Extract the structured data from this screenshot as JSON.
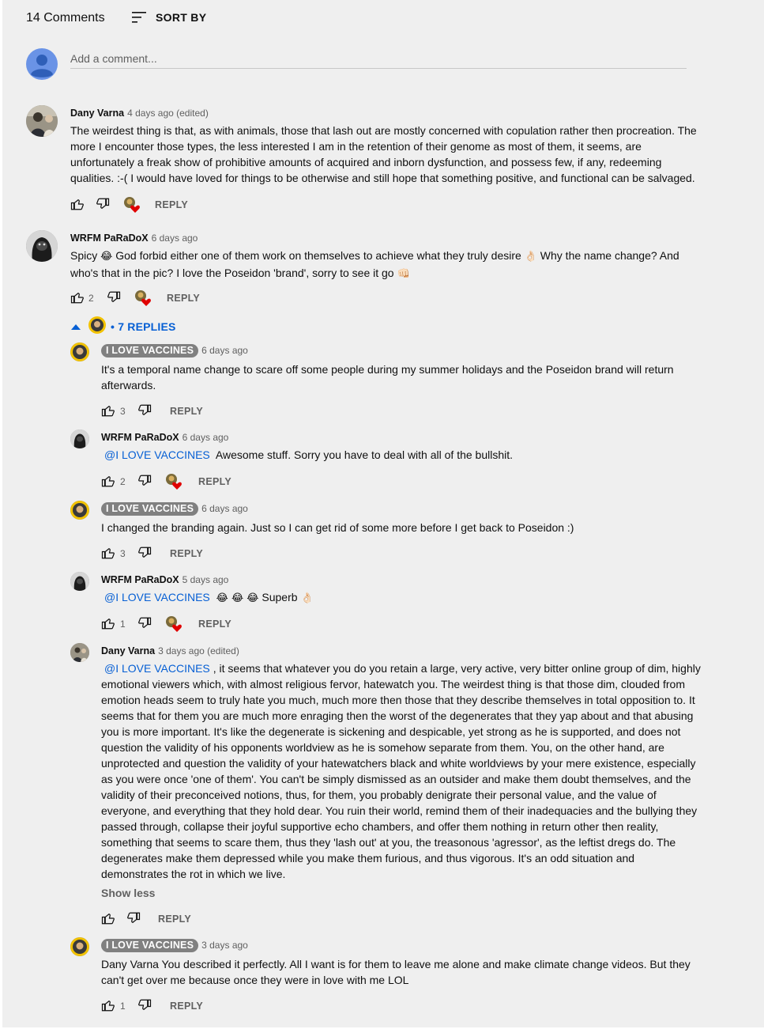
{
  "header": {
    "comment_count": "14 Comments",
    "sort_label": "SORT BY"
  },
  "composer": {
    "placeholder": "Add a comment..."
  },
  "comments": [
    {
      "author": "Dany Varna",
      "time": "4 days ago (edited)",
      "text": "The weirdest thing is that, as with animals, those that lash out are mostly concerned with copulation rather then procreation. The more I encounter those types, the less interested I am in the retention of their genome as most of them, it seems, are unfortunately a freak show of prohibitive amounts of acquired and inborn dysfunction, and possess few, if any, redeeming qualities. :-( I would have loved for things to be otherwise and still hope that something positive, and functional can be salvaged.",
      "likes": "",
      "reply_label": "REPLY"
    },
    {
      "author": "WRFM PaRaDoX",
      "time": "6 days ago",
      "text_before": "Spicy",
      "emoji1": "😂",
      "text_mid": "God forbid either one of them work on themselves to achieve what they truly desire",
      "emoji2": "👌🏻",
      "text_after": "Why the name change? And who's that in the pic? I love the Poseidon 'brand', sorry to see it go",
      "emoji3": "👊🏻",
      "likes": "2",
      "reply_label": "REPLY"
    }
  ],
  "replies_toggle": {
    "label": "• 7 REPLIES"
  },
  "replies": [
    {
      "author": "I LOVE VACCINES",
      "time": "6 days ago",
      "text": "It's a temporal name change to scare off some people during my summer holidays and the Poseidon brand will return afterwards.",
      "likes": "3",
      "reply_label": "REPLY"
    },
    {
      "author": "WRFM PaRaDoX",
      "time": "6 days ago",
      "mention": "@I LOVE VACCINES",
      "text": "Awesome stuff. Sorry you have to deal with all of the bullshit.",
      "likes": "2",
      "reply_label": "REPLY"
    },
    {
      "author": "I LOVE VACCINES",
      "time": "6 days ago",
      "text": "I changed the branding again. Just so I can get rid of some more before I get back to Poseidon :)",
      "likes": "3",
      "reply_label": "REPLY"
    },
    {
      "author": "WRFM PaRaDoX",
      "time": "5 days ago",
      "mention": "@I LOVE VACCINES",
      "emojis": "😂 😂 😂",
      "text": "Superb",
      "emoji_end": "👌🏻",
      "likes": "1",
      "reply_label": "REPLY"
    },
    {
      "author": "Dany Varna",
      "time": "3 days ago (edited)",
      "mention": "@I LOVE VACCINES",
      "text": ", it seems that whatever you do you retain a large, very active, very bitter online group of dim, highly emotional viewers which, with almost religious fervor, hatewatch you. The weirdest thing is that those dim, clouded from emotion heads seem to truly hate you much, much more then those that they describe themselves in total opposition to. It seems that for them you are much more enraging then the worst of the degenerates that they yap about and that abusing you is more important. It's like the degenerate is sickening and despicable, yet strong as he is supported, and does not question the validity of his opponents worldview as he is somehow separate from them. You, on the other hand, are unprotected and question the validity of your hatewatchers black and white worldviews by your mere existence, especially as you were once 'one of them'. You can't be simply dismissed as an outsider and make them doubt themselves, and the validity of their preconceived notions, thus, for them, you probably denigrate their personal value, and the value of everyone, and everything that they hold dear. You ruin their world, remind them of their inadequacies and the bullying they passed through, collapse their joyful supportive echo chambers, and offer them nothing in return other then reality, something that seems to scare them, thus they 'lash out' at you, the treasonous 'agressor', as the leftist dregs do. The degenerates make them depressed while you make them furious, and thus vigorous. It's an odd situation and demonstrates the rot in which we live.",
      "show_less": "Show less",
      "likes": "",
      "reply_label": "REPLY"
    },
    {
      "author": "I LOVE VACCINES",
      "time": "3 days ago",
      "text": "Dany Varna You described it perfectly. All I want is for them to leave me alone and make climate change videos. But they can't get over me because once they were in love with me LOL",
      "likes": "1",
      "reply_label": "REPLY"
    }
  ],
  "colors": {
    "panel_bg": "#efefef",
    "link_blue": "#065fd4",
    "muted": "#606060",
    "heart_red": "#e00000",
    "badge_grey": "#808080",
    "avatar_blue": "#6a93e6"
  },
  "icons": [
    "sort-icon",
    "user-avatar-icon",
    "thumb-up-icon",
    "thumb-down-icon",
    "creator-heart-icon",
    "chevron-up-icon"
  ]
}
